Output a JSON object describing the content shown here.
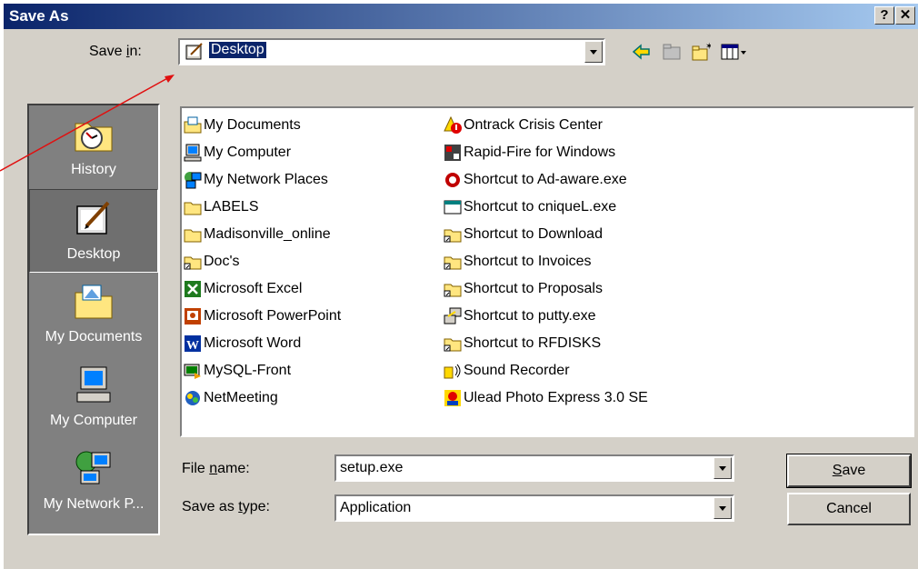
{
  "window": {
    "title": "Save As",
    "help_label": "?",
    "close_label": "✕"
  },
  "save_in": {
    "label_pre": "Save ",
    "label_u": "i",
    "label_post": "n:",
    "value": "Desktop"
  },
  "toolbar_icons": [
    "back-icon",
    "up-folder-icon",
    "new-folder-icon",
    "view-menu-icon"
  ],
  "places": [
    {
      "label": "History",
      "icon": "history-icon"
    },
    {
      "label": "Desktop",
      "icon": "desktop-icon",
      "selected": true
    },
    {
      "label": "My Documents",
      "icon": "my-documents-icon"
    },
    {
      "label": "My Computer",
      "icon": "my-computer-icon"
    },
    {
      "label": "My Network P...",
      "icon": "my-network-places-icon"
    }
  ],
  "files_col1": [
    {
      "name": "My Documents",
      "icon": "mydocs"
    },
    {
      "name": "My Computer",
      "icon": "computer"
    },
    {
      "name": "My Network Places",
      "icon": "network"
    },
    {
      "name": "LABELS",
      "icon": "folder"
    },
    {
      "name": "Madisonville_online",
      "icon": "folder"
    },
    {
      "name": "Doc's",
      "icon": "folder-shortcut"
    },
    {
      "name": "Microsoft Excel",
      "icon": "excel"
    },
    {
      "name": "Microsoft PowerPoint",
      "icon": "powerpoint"
    },
    {
      "name": "Microsoft Word",
      "icon": "word"
    },
    {
      "name": "MySQL-Front",
      "icon": "app"
    },
    {
      "name": "NetMeeting",
      "icon": "netmeeting"
    }
  ],
  "files_col2": [
    {
      "name": "Ontrack Crisis Center",
      "icon": "warning"
    },
    {
      "name": "Rapid-Fire for Windows",
      "icon": "app2"
    },
    {
      "name": "Shortcut to Ad-aware.exe",
      "icon": "adaware"
    },
    {
      "name": "Shortcut to cniqueL.exe",
      "icon": "exe"
    },
    {
      "name": "Shortcut to Download",
      "icon": "folder-shortcut"
    },
    {
      "name": "Shortcut to Invoices",
      "icon": "folder-shortcut"
    },
    {
      "name": "Shortcut to Proposals",
      "icon": "folder-shortcut"
    },
    {
      "name": "Shortcut to putty.exe",
      "icon": "putty"
    },
    {
      "name": "Shortcut to RFDISKS",
      "icon": "folder-shortcut"
    },
    {
      "name": "Sound Recorder",
      "icon": "sound"
    },
    {
      "name": "Ulead Photo Express 3.0 SE",
      "icon": "ulead"
    }
  ],
  "file_name": {
    "label_pre": "File ",
    "label_u": "n",
    "label_post": "ame:",
    "value": "setup.exe"
  },
  "save_type": {
    "label_pre": "Save as ",
    "label_u": "t",
    "label_post": "ype:",
    "value": "Application"
  },
  "buttons": {
    "save_u": "S",
    "save_rest": "ave",
    "cancel": "Cancel"
  }
}
